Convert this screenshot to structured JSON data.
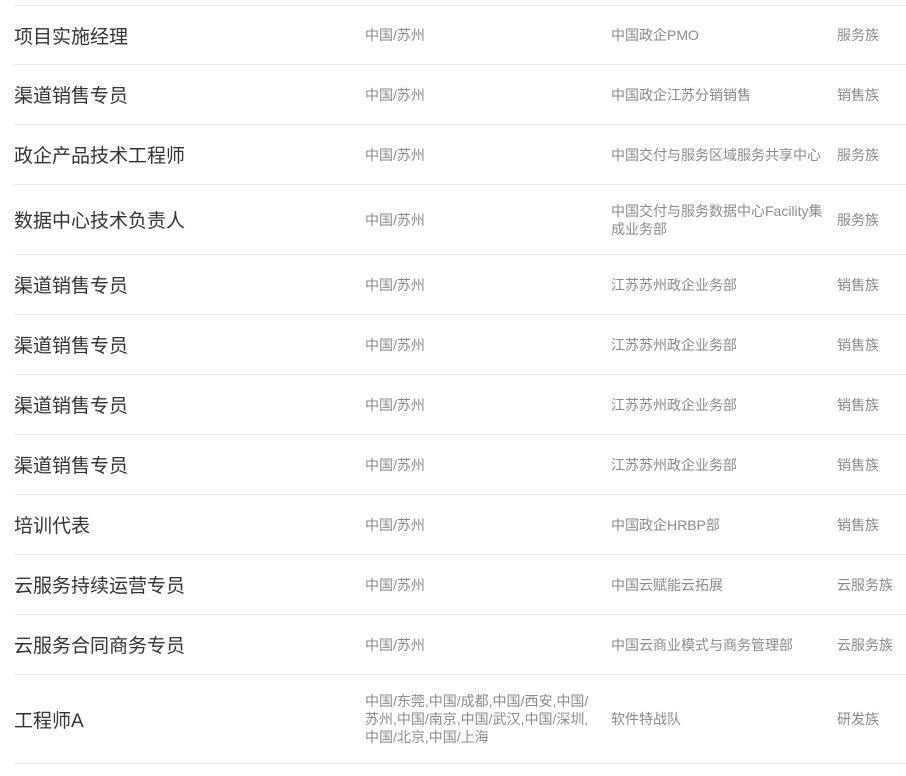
{
  "jobs": [
    {
      "title": "项目实施经理",
      "location": "中国/苏州",
      "department": "中国政企PMO",
      "family": "服务族"
    },
    {
      "title": "渠道销售专员",
      "location": "中国/苏州",
      "department": "中国政企江苏分销销售",
      "family": "销售族"
    },
    {
      "title": "政企产品技术工程师",
      "location": "中国/苏州",
      "department": "中国交付与服务区域服务共享中心",
      "family": "服务族"
    },
    {
      "title": "数据中心技术负责人",
      "location": "中国/苏州",
      "department": "中国交付与服务数据中心Facility集成业务部",
      "family": "服务族"
    },
    {
      "title": "渠道销售专员",
      "location": "中国/苏州",
      "department": "江苏苏州政企业务部",
      "family": "销售族"
    },
    {
      "title": "渠道销售专员",
      "location": "中国/苏州",
      "department": "江苏苏州政企业务部",
      "family": "销售族"
    },
    {
      "title": "渠道销售专员",
      "location": "中国/苏州",
      "department": "江苏苏州政企业务部",
      "family": "销售族"
    },
    {
      "title": "渠道销售专员",
      "location": "中国/苏州",
      "department": "江苏苏州政企业务部",
      "family": "销售族"
    },
    {
      "title": "培训代表",
      "location": "中国/苏州",
      "department": "中国政企HRBP部",
      "family": "销售族"
    },
    {
      "title": "云服务持续运营专员",
      "location": "中国/苏州",
      "department": "中国云赋能云拓展",
      "family": "云服务族"
    },
    {
      "title": "云服务合同商务专员",
      "location": "中国/苏州",
      "department": "中国云商业模式与商务管理部",
      "family": "云服务族"
    },
    {
      "title": "工程师A",
      "location": "中国/东莞,中国/成都,中国/西安,中国/苏州,中国/南京,中国/武汉,中国/深圳,中国/北京,中国/上海",
      "department": "软件特战队",
      "family": "研发族"
    }
  ]
}
